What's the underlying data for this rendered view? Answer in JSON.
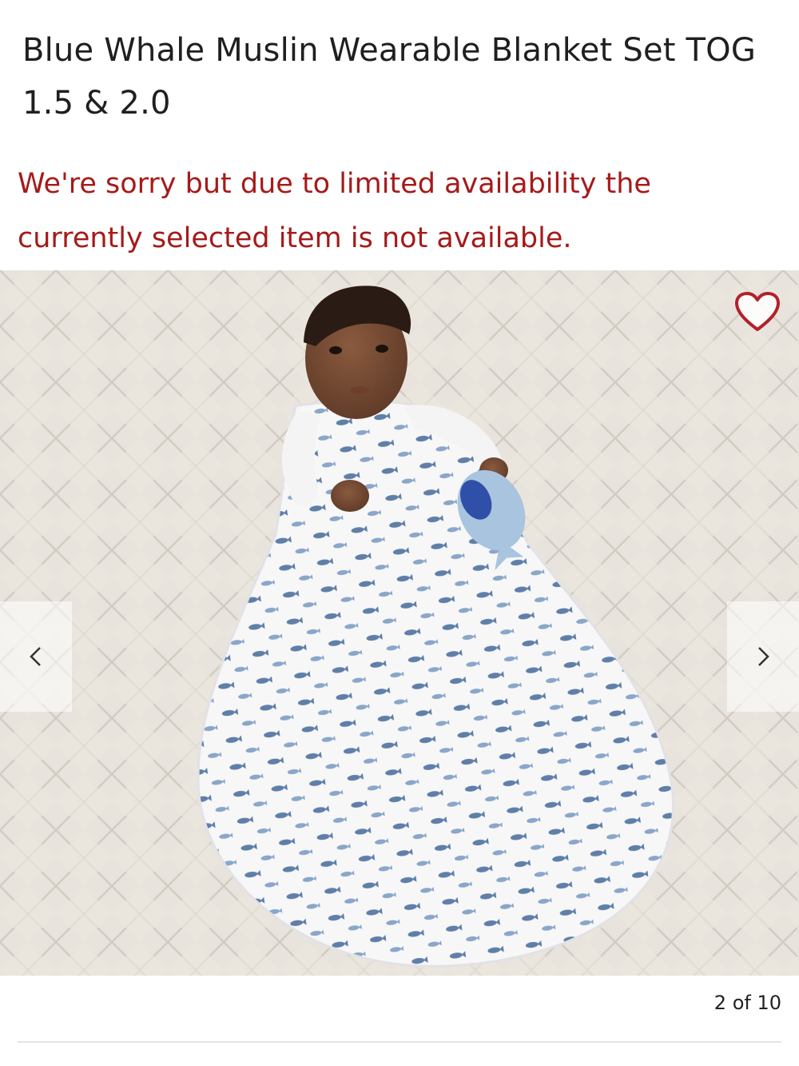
{
  "product": {
    "title": "Blue Whale Muslin Wearable Blanket Set TOG 1.5 & 2.0"
  },
  "availability": {
    "message": "We're sorry but due to limited availability the currently selected item is not available.",
    "color": "#a61a1a"
  },
  "gallery": {
    "image_alt": "Baby lying on a quilted blanket wearing a blue whale print muslin wearable blanket, holding a knitted whale toy",
    "favorite_icon": "heart-outline-icon",
    "favorite_color": "#b3202a",
    "prev_icon": "chevron-left-icon",
    "next_icon": "chevron-right-icon",
    "pagination": "2 of 10"
  }
}
